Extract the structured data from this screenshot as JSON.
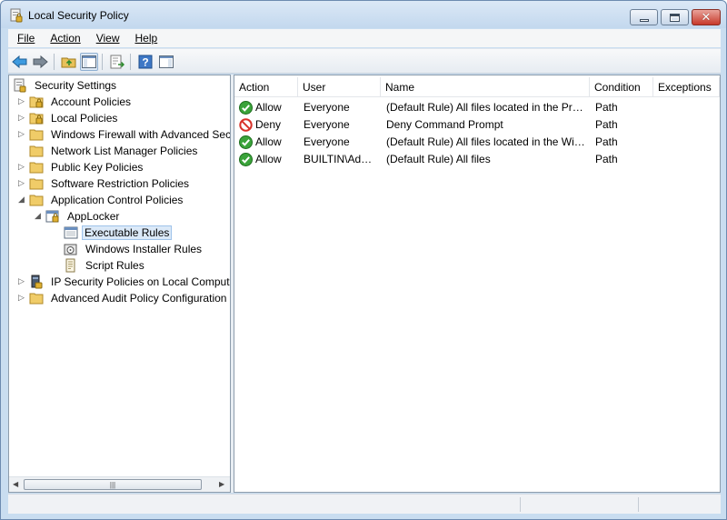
{
  "window": {
    "title": "Local Security Policy"
  },
  "menu": {
    "file": "File",
    "action": "Action",
    "view": "View",
    "help": "Help"
  },
  "toolbar": {
    "buttons": [
      "back-icon",
      "forward-icon",
      "up-folder-icon",
      "show-hide-tree-icon",
      "export-list-icon",
      "help-icon",
      "show-action-pane-icon"
    ]
  },
  "tree": {
    "root": "Security Settings",
    "items": [
      {
        "label": "Account Policies"
      },
      {
        "label": "Local Policies"
      },
      {
        "label": "Windows Firewall with Advanced Security"
      },
      {
        "label": "Network List Manager Policies"
      },
      {
        "label": "Public Key Policies"
      },
      {
        "label": "Software Restriction Policies"
      },
      {
        "label": "Application Control Policies"
      },
      {
        "label": "AppLocker"
      },
      {
        "label": "Executable Rules"
      },
      {
        "label": "Windows Installer Rules"
      },
      {
        "label": "Script Rules"
      },
      {
        "label": "IP Security Policies on Local Computer"
      },
      {
        "label": "Advanced Audit Policy Configuration"
      }
    ],
    "hscroll_grip": "|||"
  },
  "list": {
    "columns": [
      "Action",
      "User",
      "Name",
      "Condition",
      "Exceptions"
    ],
    "rows": [
      {
        "action": "Allow",
        "status": "allow",
        "user": "Everyone",
        "name": "(Default Rule) All files located in the Program Files folder",
        "condition": "Path",
        "exceptions": ""
      },
      {
        "action": "Deny",
        "status": "deny",
        "user": "Everyone",
        "name": "Deny Command Prompt",
        "condition": "Path",
        "exceptions": ""
      },
      {
        "action": "Allow",
        "status": "allow",
        "user": "Everyone",
        "name": "(Default Rule) All files located in the Windows folder",
        "condition": "Path",
        "exceptions": ""
      },
      {
        "action": "Allow",
        "status": "allow",
        "user": "BUILTIN\\Administrators",
        "name": "(Default Rule) All files",
        "condition": "Path",
        "exceptions": ""
      }
    ]
  },
  "colors": {
    "allow": "#3aa33a",
    "deny": "#d8322a",
    "selection": "#dbe9f8",
    "frame": "#c9ddf0"
  }
}
